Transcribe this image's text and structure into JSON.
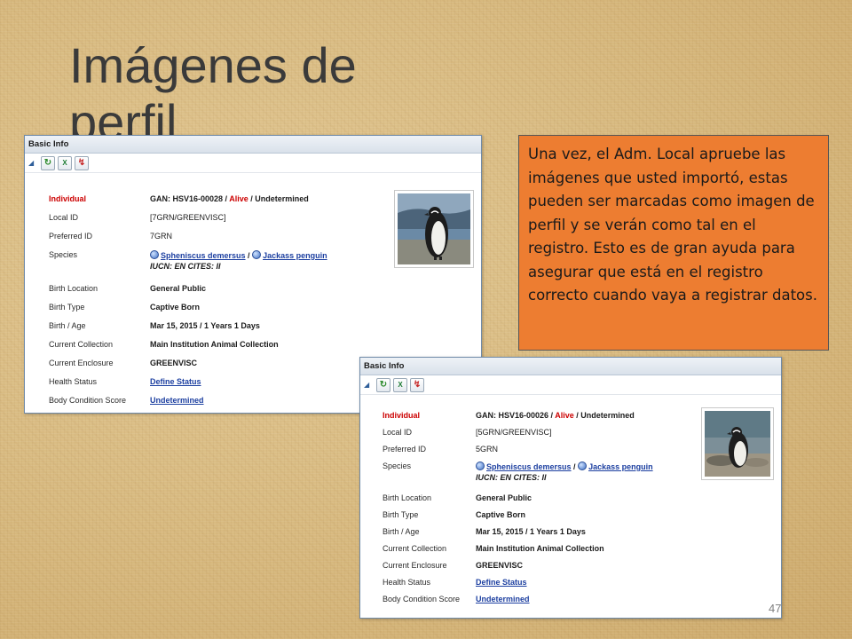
{
  "slide": {
    "title": "Imágenes de perfil",
    "callout_text": "Una vez, el Adm. Local apruebe las imágenes que usted importó, estas pueden ser marcadas como imagen de perfil y se verán como tal en el registro. Esto es de gran ayuda para asegurar que está en el registro correcto cuando vaya a registrar datos.",
    "page_number": "47",
    "callout_color": "#ed7d31"
  },
  "panel1": {
    "header": "Basic Info",
    "toolbar": [
      "refresh-icon",
      "excel-export-icon",
      "pdf-export-icon"
    ],
    "individual_label": "Individual",
    "individual_gan": "GAN: HSV16-00028 / ",
    "individual_status": "Alive",
    "individual_sex": " / Undetermined",
    "local_id_label": "Local ID",
    "local_id": "[7GRN/GREENVISC]",
    "preferred_id_label": "Preferred ID",
    "preferred_id": "7GRN",
    "species_label": "Species",
    "species_scientific": "Spheniscus demersus",
    "species_sep": " / ",
    "species_common": "Jackass penguin",
    "species_status": "IUCN: EN   CITES: II",
    "birth_location_label": "Birth Location",
    "birth_location": "General Public",
    "birth_type_label": "Birth Type",
    "birth_type": "Captive Born",
    "birth_age_label": "Birth / Age",
    "birth_age": "Mar 15, 2015 / 1 Years 1 Days",
    "current_collection_label": "Current Collection",
    "current_collection": "Main Institution Animal Collection",
    "current_enclosure_label": "Current Enclosure",
    "current_enclosure": "GREENVISC",
    "health_status_label": "Health Status",
    "health_status": "Define Status",
    "bcs_label": "Body Condition Score",
    "bcs": "Undetermined"
  },
  "panel2": {
    "header": "Basic Info",
    "toolbar": [
      "refresh-icon",
      "excel-export-icon",
      "pdf-export-icon"
    ],
    "individual_label": "Individual",
    "individual_gan": "GAN: HSV16-00026 / ",
    "individual_status": "Alive",
    "individual_sex": " / Undetermined",
    "local_id_label": "Local ID",
    "local_id": "[5GRN/GREENVISC]",
    "preferred_id_label": "Preferred ID",
    "preferred_id": "5GRN",
    "species_label": "Species",
    "species_scientific": "Spheniscus demersus",
    "species_sep": " / ",
    "species_common": "Jackass penguin",
    "species_status": "IUCN: EN   CITES: II",
    "birth_location_label": "Birth Location",
    "birth_location": "General Public",
    "birth_type_label": "Birth Type",
    "birth_type": "Captive Born",
    "birth_age_label": "Birth / Age",
    "birth_age": "Mar 15, 2015 / 1 Years 1 Days",
    "current_collection_label": "Current Collection",
    "current_collection": "Main Institution Animal Collection",
    "current_enclosure_label": "Current Enclosure",
    "current_enclosure": "GREENVISC",
    "health_status_label": "Health Status",
    "health_status": "Define Status",
    "bcs_label": "Body Condition Score",
    "bcs": "Undetermined"
  }
}
